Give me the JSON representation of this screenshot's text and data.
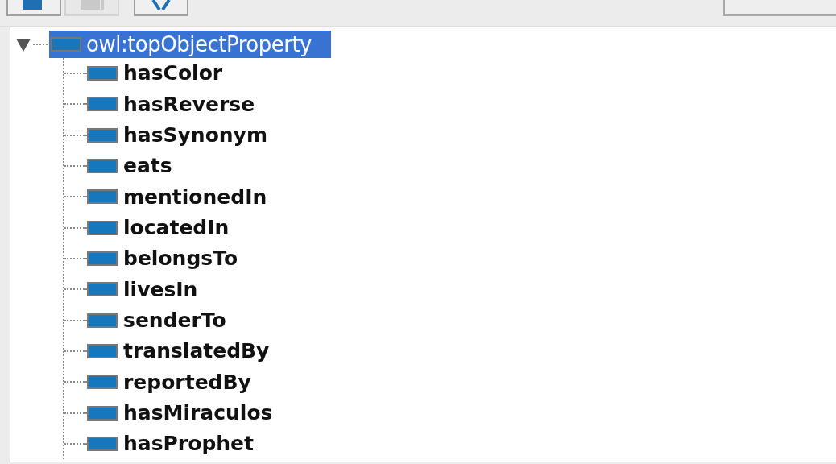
{
  "toolbar": {
    "buttons": [
      {
        "kind": "add-child",
        "disabled": false
      },
      {
        "kind": "add-sibling",
        "disabled": true
      },
      {
        "kind": "delete",
        "disabled": false
      }
    ]
  },
  "tree": {
    "label": "owl:topObjectProperty",
    "selected": true,
    "expanded": true,
    "bold": false,
    "children": [
      {
        "label": "hasColor",
        "selected": false,
        "bold": true
      },
      {
        "label": "hasReverse",
        "selected": false,
        "bold": true
      },
      {
        "label": "hasSynonym",
        "selected": false,
        "bold": true
      },
      {
        "label": "eats",
        "selected": false,
        "bold": true
      },
      {
        "label": "mentionedIn",
        "selected": false,
        "bold": true
      },
      {
        "label": "locatedIn",
        "selected": false,
        "bold": true
      },
      {
        "label": "belongsTo",
        "selected": false,
        "bold": true
      },
      {
        "label": "livesIn",
        "selected": false,
        "bold": true
      },
      {
        "label": "senderTo",
        "selected": false,
        "bold": true
      },
      {
        "label": "translatedBy",
        "selected": false,
        "bold": true
      },
      {
        "label": "reportedBy",
        "selected": false,
        "bold": true
      },
      {
        "label": "hasMiraculos",
        "selected": false,
        "bold": true
      },
      {
        "label": "hasProphet",
        "selected": false,
        "bold": true
      }
    ]
  }
}
